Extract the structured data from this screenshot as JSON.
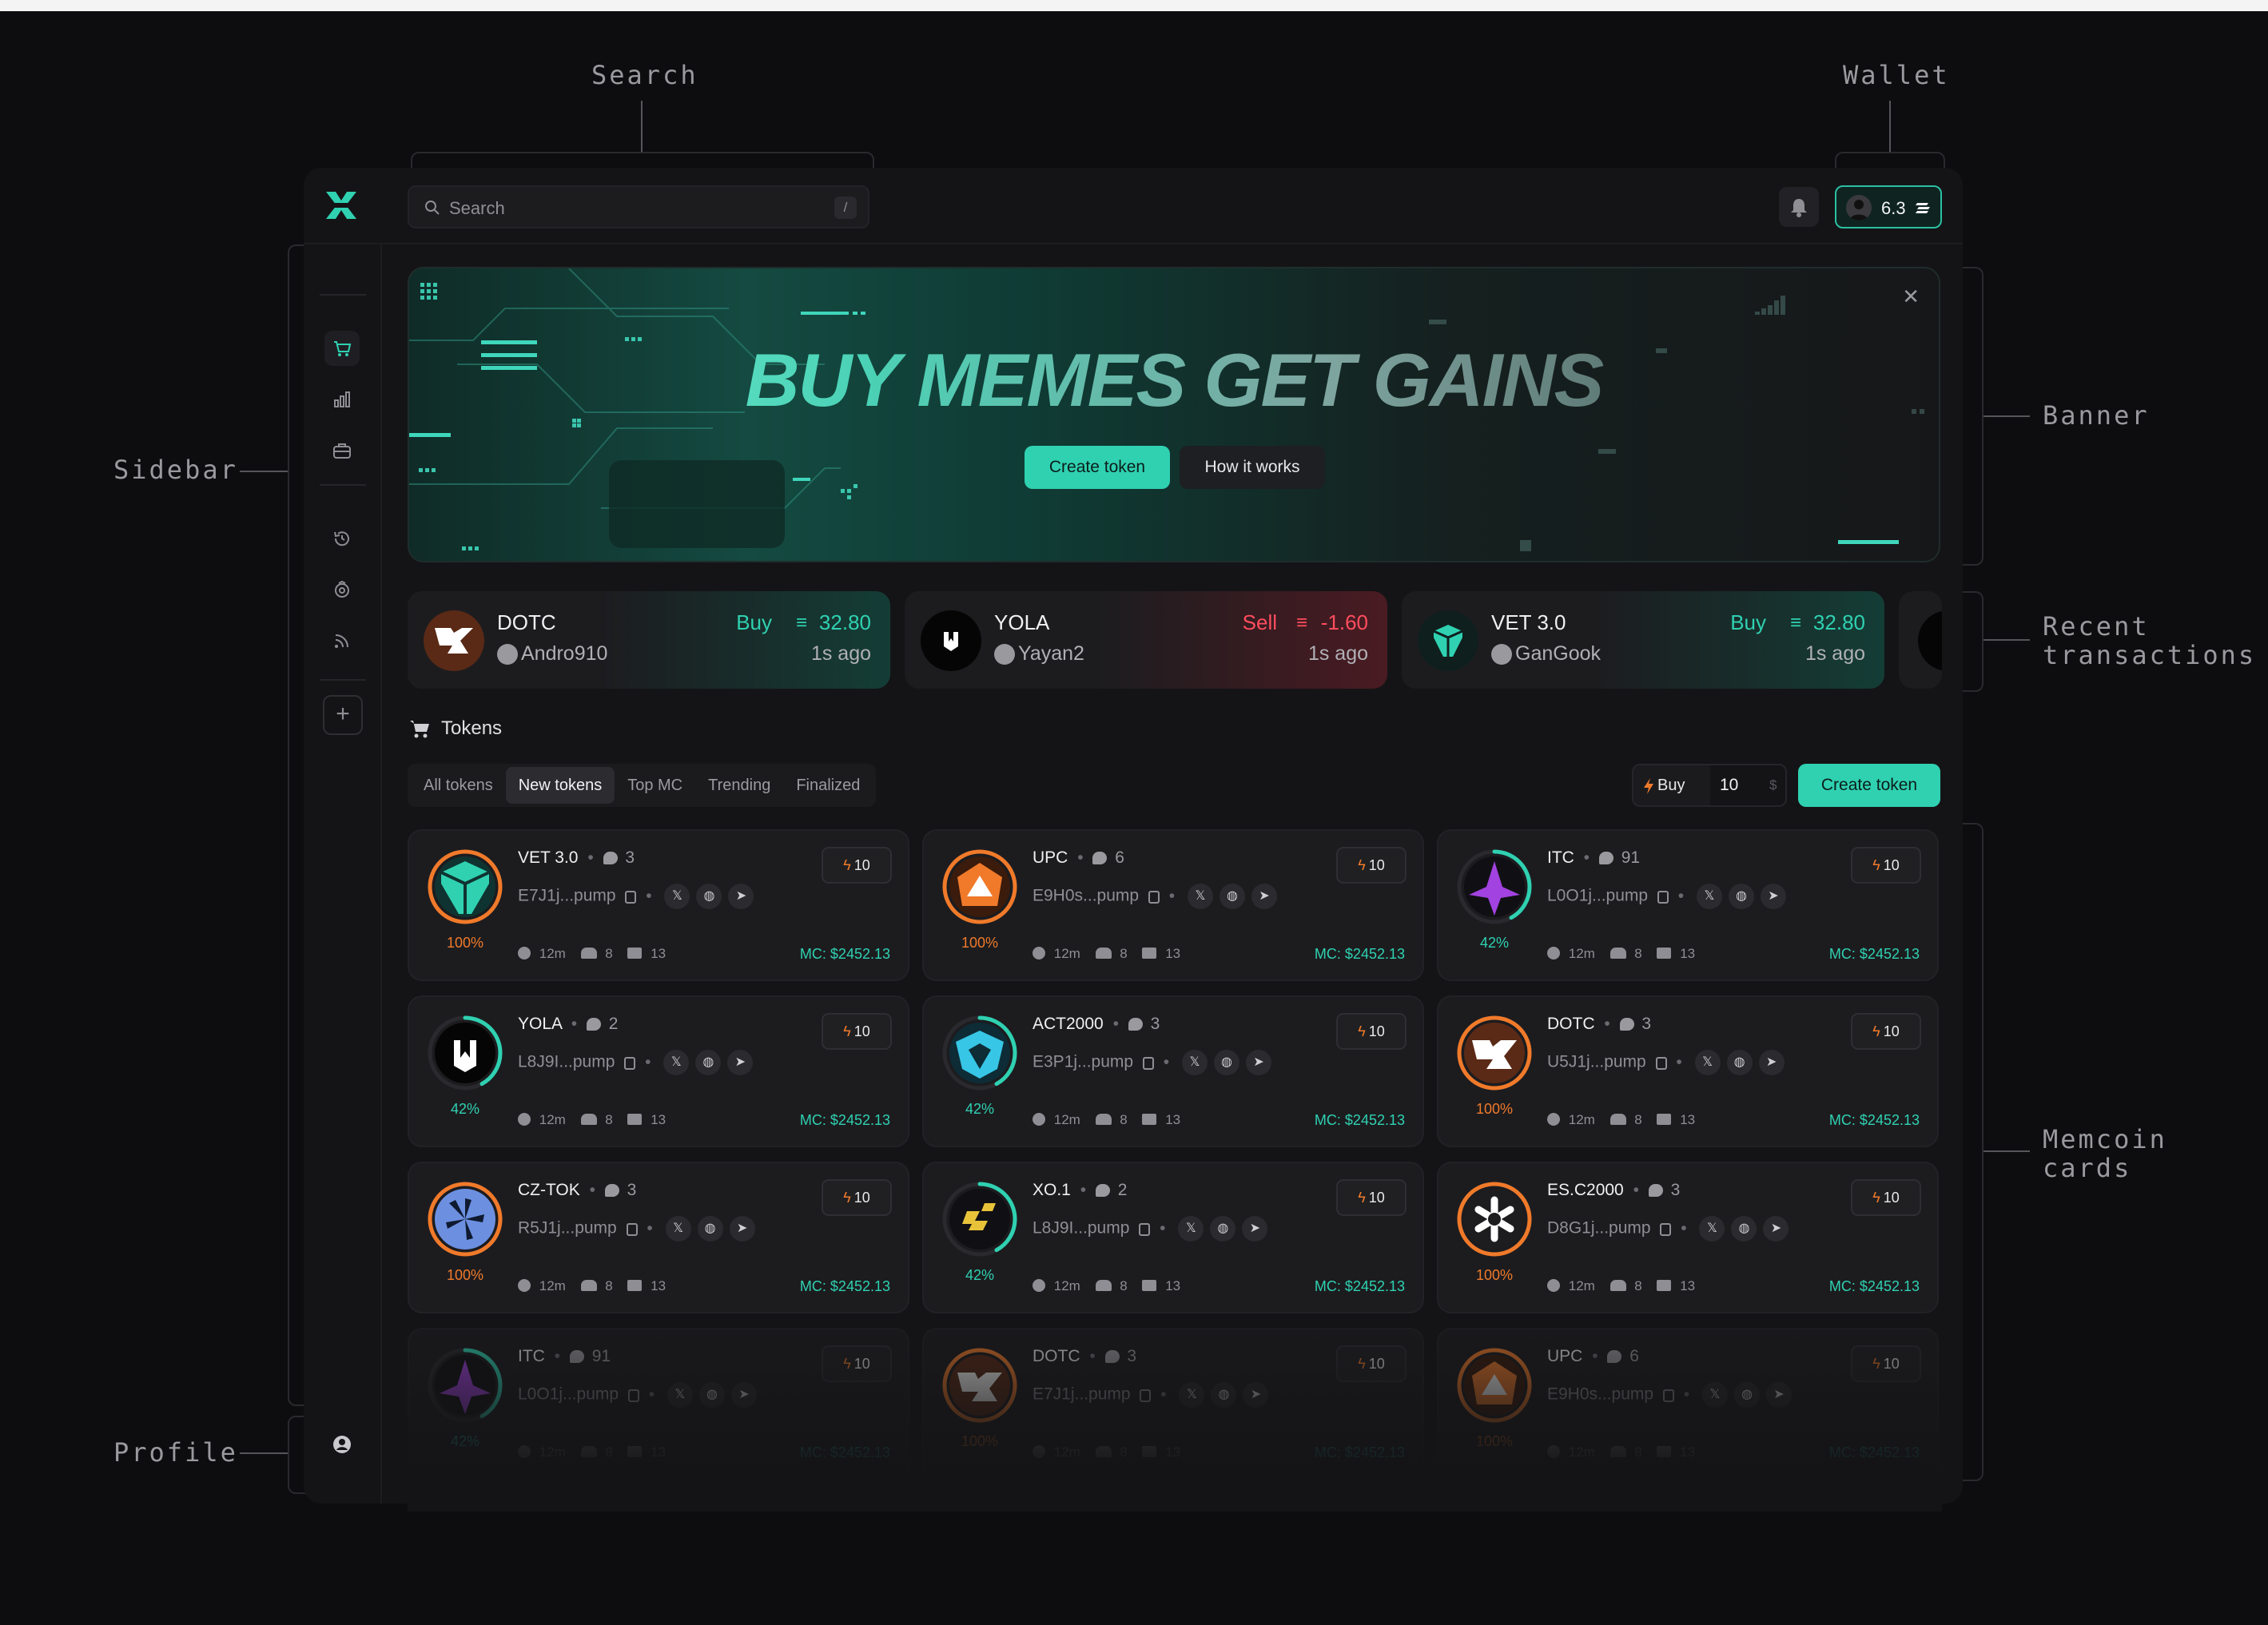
{
  "annotations": {
    "search": "Search",
    "wallet": "Wallet",
    "sidebar": "Sidebar",
    "banner": "Banner",
    "recent_transactions_1": "Recent",
    "recent_transactions_2": "transactions",
    "memcoin_cards_1": "Memcoin",
    "memcoin_cards_2": "cards",
    "profile": "Profile"
  },
  "header": {
    "search_placeholder": "Search",
    "search_shortcut": "/",
    "wallet_balance": "6.3"
  },
  "sidebar": {
    "icons": [
      "cart-icon",
      "chart-icon",
      "briefcase-icon",
      "history-icon",
      "badge-icon",
      "feed-icon",
      "plus-icon",
      "profile-icon"
    ]
  },
  "banner": {
    "headline": "BUY MEMES GET GAINS",
    "primary_button": "Create token",
    "secondary_button": "How it works"
  },
  "transactions": [
    {
      "token": "DOTC",
      "user": "Andro910",
      "side": "Buy",
      "amount": "32.80",
      "time": "1s ago"
    },
    {
      "token": "YOLA",
      "user": "Yayan2",
      "side": "Sell",
      "amount": "-1.60",
      "time": "1s ago"
    },
    {
      "token": "VET 3.0",
      "user": "GanGook",
      "side": "Buy",
      "amount": "32.80",
      "time": "1s ago"
    }
  ],
  "tokens": {
    "title": "Tokens",
    "tabs": [
      "All tokens",
      "New tokens",
      "Top MC",
      "Trending",
      "Finalized"
    ],
    "active_tab": "New tokens",
    "quick_buy_label": "Buy",
    "quick_buy_value": "10",
    "quick_buy_unit": "$",
    "create_button": "Create token"
  },
  "cards": [
    {
      "name": "VET 3.0",
      "comments": "3",
      "address": "E7J1j...pump",
      "progress": "100%",
      "age": "12m",
      "holders": "8",
      "txs": "13",
      "mc": "MC: $2452.13",
      "qb": "10"
    },
    {
      "name": "UPC",
      "comments": "6",
      "address": "E9H0s...pump",
      "progress": "100%",
      "age": "12m",
      "holders": "8",
      "txs": "13",
      "mc": "MC: $2452.13",
      "qb": "10"
    },
    {
      "name": "ITC",
      "comments": "91",
      "address": "L0O1j...pump",
      "progress": "42%",
      "age": "12m",
      "holders": "8",
      "txs": "13",
      "mc": "MC: $2452.13",
      "qb": "10"
    },
    {
      "name": "YOLA",
      "comments": "2",
      "address": "L8J9I...pump",
      "progress": "42%",
      "age": "12m",
      "holders": "8",
      "txs": "13",
      "mc": "MC: $2452.13",
      "qb": "10"
    },
    {
      "name": "ACT2000",
      "comments": "3",
      "address": "E3P1j...pump",
      "progress": "42%",
      "age": "12m",
      "holders": "8",
      "txs": "13",
      "mc": "MC: $2452.13",
      "qb": "10"
    },
    {
      "name": "DOTC",
      "comments": "3",
      "address": "U5J1j...pump",
      "progress": "100%",
      "age": "12m",
      "holders": "8",
      "txs": "13",
      "mc": "MC: $2452.13",
      "qb": "10"
    },
    {
      "name": "CZ-TOK",
      "comments": "3",
      "address": "R5J1j...pump",
      "progress": "100%",
      "age": "12m",
      "holders": "8",
      "txs": "13",
      "mc": "MC: $2452.13",
      "qb": "10"
    },
    {
      "name": "XO.1",
      "comments": "2",
      "address": "L8J9I...pump",
      "progress": "42%",
      "age": "12m",
      "holders": "8",
      "txs": "13",
      "mc": "MC: $2452.13",
      "qb": "10"
    },
    {
      "name": "ES.C2000",
      "comments": "3",
      "address": "D8G1j...pump",
      "progress": "100%",
      "age": "12m",
      "holders": "8",
      "txs": "13",
      "mc": "MC: $2452.13",
      "qb": "10"
    },
    {
      "name": "ITC",
      "comments": "91",
      "address": "L0O1j...pump",
      "progress": "42%",
      "age": "12m",
      "holders": "8",
      "txs": "13",
      "mc": "MC: $2452.13",
      "qb": "10"
    },
    {
      "name": "DOTC",
      "comments": "3",
      "address": "E7J1j...pump",
      "progress": "100%",
      "age": "12m",
      "holders": "8",
      "txs": "13",
      "mc": "MC: $2452.13",
      "qb": "10"
    },
    {
      "name": "UPC",
      "comments": "6",
      "address": "E9H0s...pump",
      "progress": "100%",
      "age": "12m",
      "holders": "8",
      "txs": "13",
      "mc": "MC: $2452.13",
      "qb": "10"
    }
  ],
  "colors": {
    "accent": "#2fd1b1",
    "sell": "#ff4d5e",
    "buy": "#2fd1b1",
    "orange": "#f07a2a"
  }
}
